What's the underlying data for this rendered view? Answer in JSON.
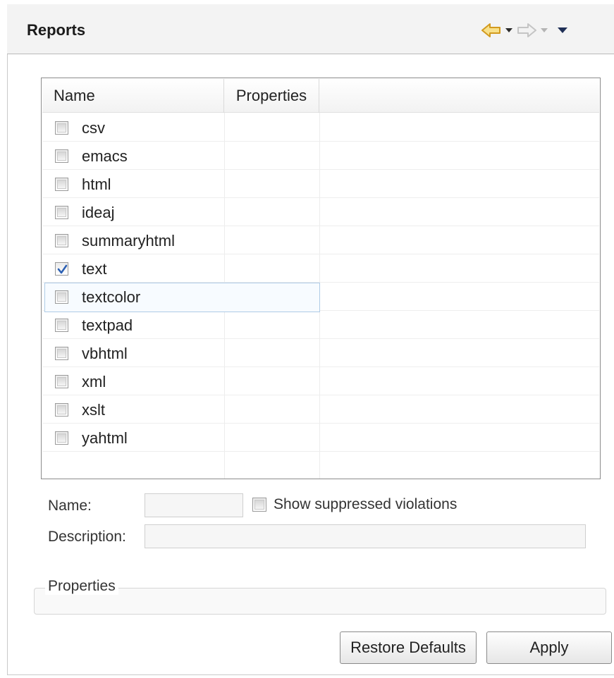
{
  "header": {
    "title": "Reports"
  },
  "table": {
    "columns": [
      "Name",
      "Properties",
      ""
    ],
    "rows": [
      {
        "name": "csv",
        "checked": false
      },
      {
        "name": "emacs",
        "checked": false
      },
      {
        "name": "html",
        "checked": false
      },
      {
        "name": "ideaj",
        "checked": false
      },
      {
        "name": "summaryhtml",
        "checked": false
      },
      {
        "name": "text",
        "checked": true
      },
      {
        "name": "textcolor",
        "checked": false,
        "focused": true
      },
      {
        "name": "textpad",
        "checked": false
      },
      {
        "name": "vbhtml",
        "checked": false
      },
      {
        "name": "xml",
        "checked": false
      },
      {
        "name": "xslt",
        "checked": false
      },
      {
        "name": "yahtml",
        "checked": false
      }
    ]
  },
  "form": {
    "name_label": "Name:",
    "name_value": "",
    "show_suppressed_label": "Show suppressed violations",
    "show_suppressed_checked": false,
    "description_label": "Description:",
    "description_value": ""
  },
  "properties_group": {
    "label": "Properties"
  },
  "buttons": {
    "restore_defaults": "Restore Defaults",
    "apply": "Apply"
  },
  "colors": {
    "back_arrow": "#e8b43a",
    "forward_arrow_disabled": "#c8c8c8",
    "check_mark": "#2b5fb3",
    "focus_border": "#aecbe6"
  },
  "icons": {
    "back": "back-arrow-icon",
    "forward": "forward-arrow-icon",
    "dropdown": "chevron-down-icon",
    "menu": "view-menu-icon"
  }
}
